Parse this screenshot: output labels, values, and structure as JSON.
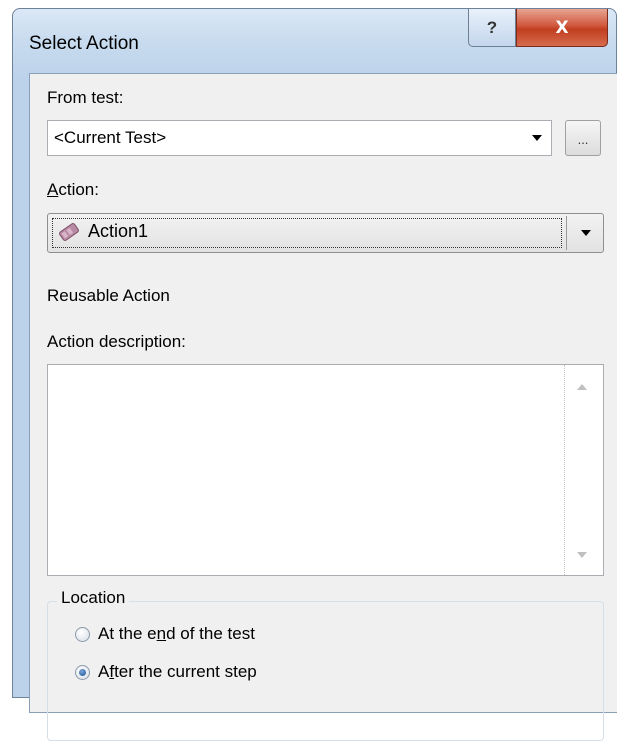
{
  "window": {
    "title": "Select Action",
    "help_glyph": "?",
    "close_glyph": "X"
  },
  "from_test": {
    "label": "From test:",
    "value": "<Current Test>",
    "browse_label": "..."
  },
  "action": {
    "label_accel": "A",
    "label_rest": "ction:",
    "value": "Action1",
    "icon": "action-icon"
  },
  "reusable_text": "Reusable Action",
  "description": {
    "label": "Action description:",
    "value": ""
  },
  "location": {
    "title": "Location",
    "options": [
      {
        "pre": "At the e",
        "accel": "n",
        "post": "d of the test",
        "selected": false
      },
      {
        "pre": "A",
        "accel": "f",
        "post": "ter the current step",
        "selected": true
      }
    ]
  },
  "colors": {
    "close_button": "#c94a2c",
    "dialog_bg": "#f0f0f0",
    "frame": "#bcd2ea"
  }
}
